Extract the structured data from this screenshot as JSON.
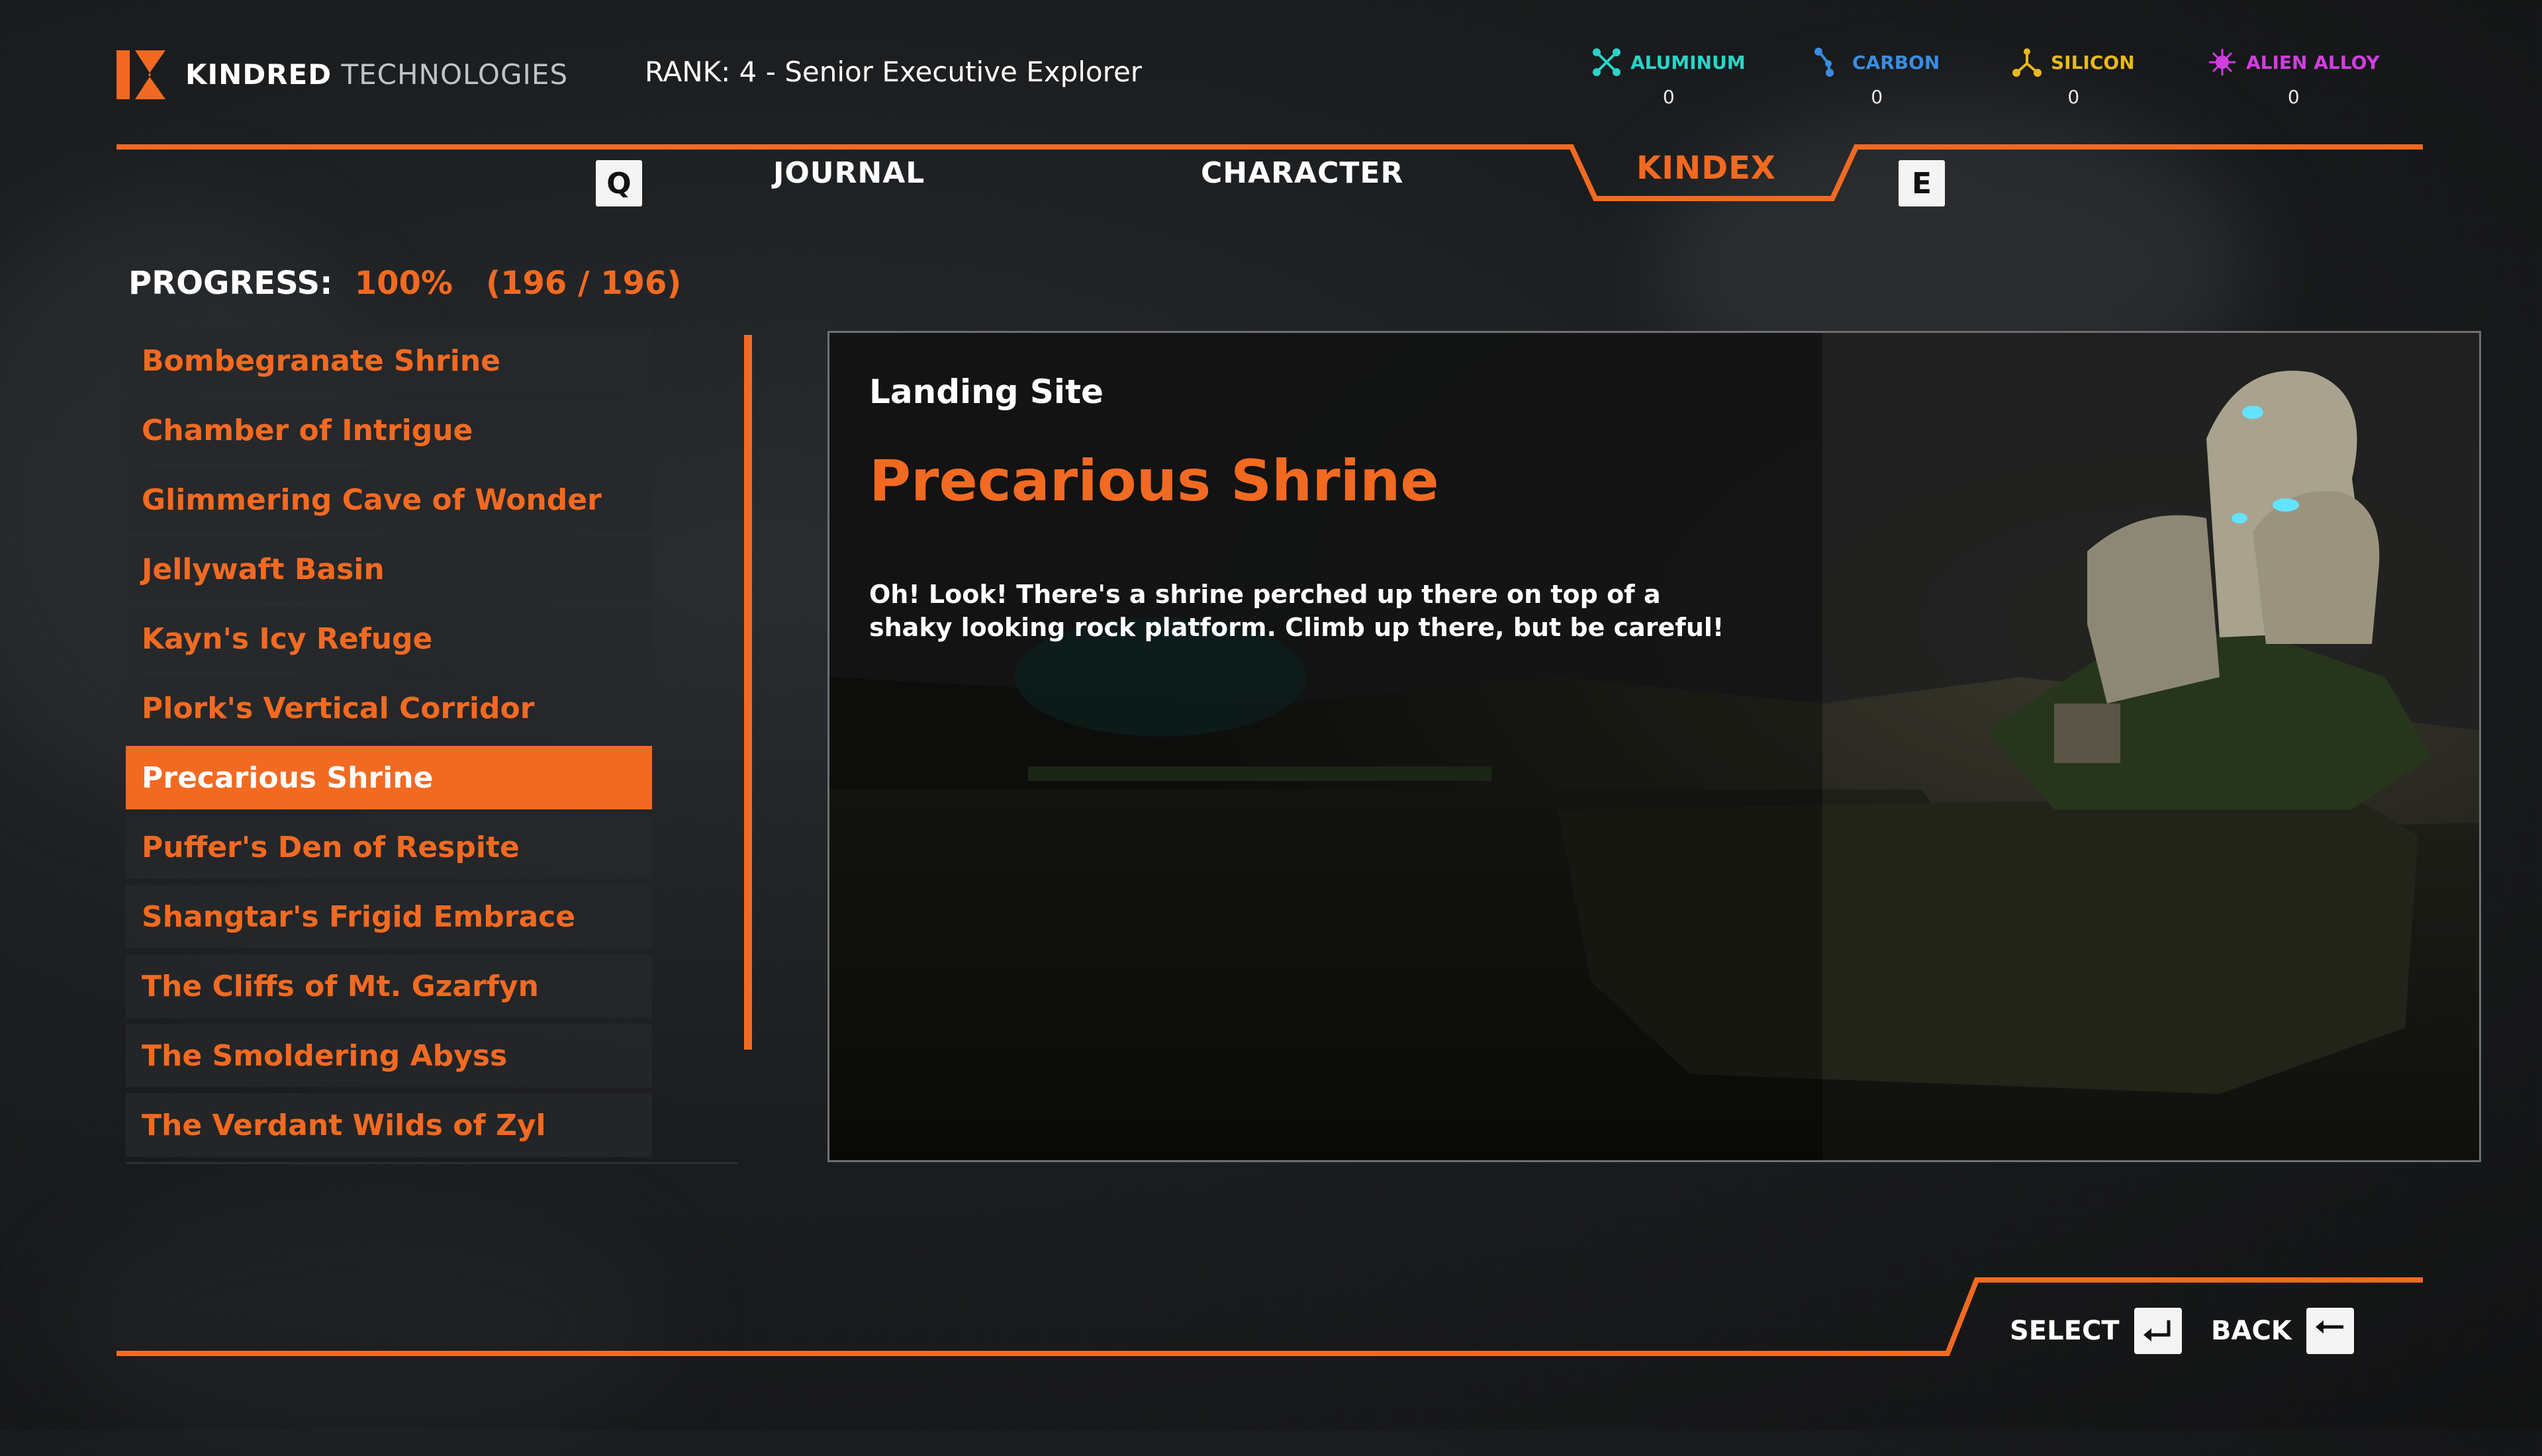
{
  "header": {
    "brand_primary": "KINDRED",
    "brand_secondary": "TECHNOLOGIES",
    "rank_text": "RANK: 4 - Senior Executive Explorer"
  },
  "resources": [
    {
      "name": "ALUMINUM",
      "value": "0",
      "color": "#2ad3c8",
      "icon": "aluminum-icon"
    },
    {
      "name": "CARBON",
      "value": "0",
      "color": "#3a8de0",
      "icon": "carbon-icon"
    },
    {
      "name": "SILICON",
      "value": "0",
      "color": "#e8b820",
      "icon": "silicon-icon"
    },
    {
      "name": "ALIEN ALLOY",
      "value": "0",
      "color": "#d23ee0",
      "icon": "alien-alloy-icon"
    }
  ],
  "tabs": {
    "prev_key": "Q",
    "next_key": "E",
    "items": [
      "JOURNAL",
      "CHARACTER",
      "KINDEX"
    ],
    "active": "KINDEX"
  },
  "progress": {
    "label": "PROGRESS:",
    "percent": "100%",
    "count": "(196 / 196)"
  },
  "list": {
    "items": [
      "Bombegranate Shrine",
      "Chamber of Intrigue",
      "Glimmering Cave of Wonder",
      "Jellywaft Basin",
      "Kayn's Icy Refuge",
      "Plork's Vertical Corridor",
      "Precarious Shrine",
      "Puffer's Den of Respite",
      "Shangtar's Frigid Embrace",
      "The Cliffs of Mt. Gzarfyn",
      "The Smoldering Abyss",
      "The Verdant Wilds of Zyl"
    ],
    "selected_index": 6
  },
  "detail": {
    "region": "Landing Site",
    "title": "Precarious Shrine",
    "description": "Oh! Look! There's a shrine perched up there on top of a shaky looking rock platform. Climb up there, but be careful!"
  },
  "footer": {
    "select_label": "SELECT",
    "back_label": "BACK"
  },
  "colors": {
    "accent": "#f26a22"
  }
}
